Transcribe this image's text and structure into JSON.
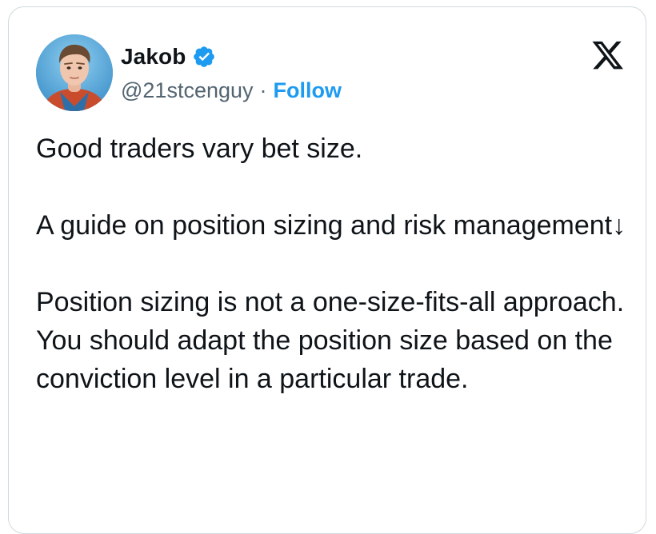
{
  "author": {
    "name": "Jakob",
    "handle": "@21stcenguy",
    "separator": "·",
    "follow_label": "Follow",
    "verified": true,
    "avatar_icon": "profile-photo"
  },
  "platform": {
    "logo_icon": "x-logo-icon"
  },
  "tweet": {
    "paragraphs": [
      "Good traders vary bet size.",
      "A guide on position sizing and risk management↓",
      "Position sizing is not a one-size-fits-all approach. You should adapt the position size based on the conviction level in a particular trade."
    ]
  },
  "colors": {
    "accent": "#1d9bf0",
    "text": "#0f1419",
    "secondary": "#536471",
    "border": "#cfd9de"
  }
}
